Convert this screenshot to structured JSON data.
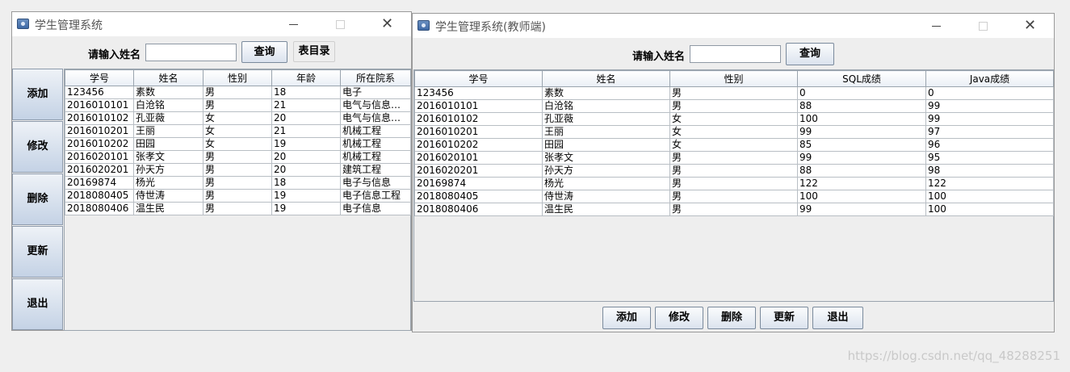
{
  "left_window": {
    "title": "学生管理系统",
    "search_label": "请输入姓名",
    "search_value": "",
    "query_button": "查询",
    "table_dir_button": "表目录",
    "side_buttons": [
      "添加",
      "修改",
      "删除",
      "更新",
      "退出"
    ],
    "columns": [
      "学号",
      "姓名",
      "性别",
      "年龄",
      "所在院系"
    ],
    "rows": [
      [
        "123456",
        "素数",
        "男",
        "18",
        "电子"
      ],
      [
        "2016010101",
        "白沧铭",
        "男",
        "21",
        "电气与信息工..."
      ],
      [
        "2016010102",
        "孔亚薇",
        "女",
        "20",
        "电气与信息工..."
      ],
      [
        "2016010201",
        "王丽",
        "女",
        "21",
        "机械工程"
      ],
      [
        "2016010202",
        "田园",
        "女",
        "19",
        "机械工程"
      ],
      [
        "2016020101",
        "张孝文",
        "男",
        "20",
        "机械工程"
      ],
      [
        "2016020201",
        "孙天方",
        "男",
        "20",
        "建筑工程"
      ],
      [
        "20169874",
        "杨光",
        "男",
        "18",
        "电子与信息"
      ],
      [
        "2018080405",
        "侍世涛",
        "男",
        "19",
        "电子信息工程"
      ],
      [
        "2018080406",
        "温生民",
        "男",
        "19",
        "电子信息"
      ]
    ]
  },
  "right_window": {
    "title": "学生管理系统(教师端)",
    "search_label": "请输入姓名",
    "search_value": "",
    "query_button": "查询",
    "bottom_buttons": [
      "添加",
      "修改",
      "删除",
      "更新",
      "退出"
    ],
    "columns": [
      "学号",
      "姓名",
      "性别",
      "SQL成绩",
      "Java成绩"
    ],
    "rows": [
      [
        "123456",
        "素数",
        "男",
        "0",
        "0"
      ],
      [
        "2016010101",
        "白沧铭",
        "男",
        "88",
        "99"
      ],
      [
        "2016010102",
        "孔亚薇",
        "女",
        "100",
        "99"
      ],
      [
        "2016010201",
        "王丽",
        "女",
        "99",
        "97"
      ],
      [
        "2016010202",
        "田园",
        "女",
        "85",
        "96"
      ],
      [
        "2016020101",
        "张孝文",
        "男",
        "99",
        "95"
      ],
      [
        "2016020201",
        "孙天方",
        "男",
        "88",
        "98"
      ],
      [
        "20169874",
        "杨光",
        "男",
        "122",
        "122"
      ],
      [
        "2018080405",
        "侍世涛",
        "男",
        "100",
        "100"
      ],
      [
        "2018080406",
        "温生民",
        "男",
        "99",
        "100"
      ]
    ]
  },
  "watermark": "https://blog.csdn.net/qq_48288251"
}
